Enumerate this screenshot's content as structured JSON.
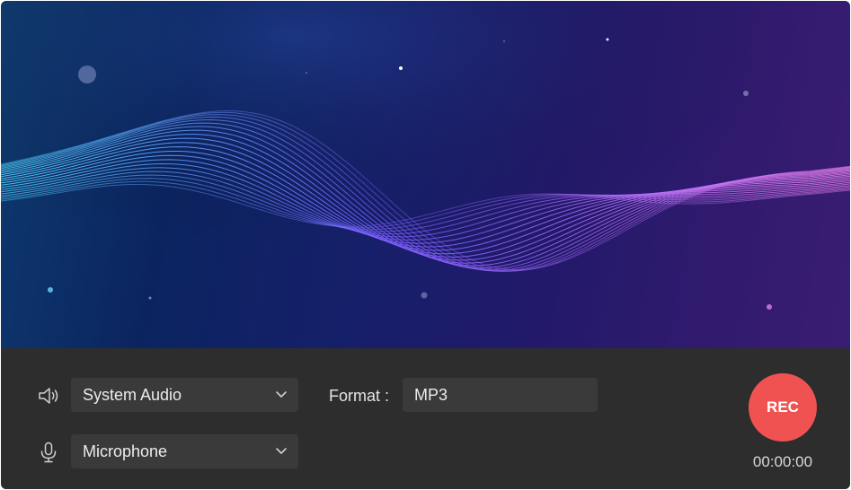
{
  "audio": {
    "system_audio": {
      "label": "System Audio",
      "icon": "speaker-icon"
    },
    "microphone": {
      "label": "Microphone",
      "icon": "microphone-icon"
    }
  },
  "format": {
    "label": "Format :",
    "value": "MP3"
  },
  "record": {
    "button_label": "REC",
    "timer": "00:00:00",
    "color": "#f05252"
  },
  "theme": {
    "panel_bg": "#2d2d2d",
    "field_bg": "#3a3a3a",
    "wave_start": "#4fd6ff",
    "wave_mid": "#7c5cff",
    "wave_end": "#e07ae8"
  }
}
